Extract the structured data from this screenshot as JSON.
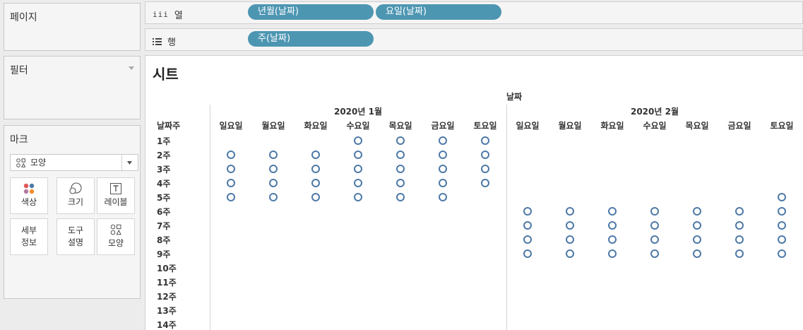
{
  "pages_card": {
    "title": "페이지"
  },
  "filters_card": {
    "title": "필터"
  },
  "marks_card": {
    "title": "마크",
    "mark_type": "모양",
    "buttons": [
      {
        "label": "색상",
        "icon": "color-dots-icon"
      },
      {
        "label": "크기",
        "icon": "size-icon"
      },
      {
        "label": "레이블",
        "icon": "label-text-icon"
      },
      {
        "label_line1": "세부",
        "label_line2": "정보",
        "icon": "none"
      },
      {
        "label_line1": "도구",
        "label_line2": "설명",
        "icon": "none"
      },
      {
        "label": "모양",
        "icon": "shape-icon"
      }
    ]
  },
  "columns_shelf": {
    "label": "열",
    "icon": "iii",
    "pills": [
      "년월(날짜)",
      "요일(날짜)"
    ]
  },
  "rows_shelf": {
    "label": "행",
    "pills": [
      "주(날짜)"
    ]
  },
  "sheet": {
    "title": "시트",
    "top_header": "날짜",
    "row_header": "날짜주",
    "months": [
      "2020년 1월",
      "2020년 2월"
    ],
    "weekdays": [
      "일요일",
      "월요일",
      "화요일",
      "수요일",
      "목요일",
      "금요일",
      "토요일"
    ],
    "weeks": [
      "1주",
      "2주",
      "3주",
      "4주",
      "5주",
      "6주",
      "7주",
      "8주",
      "9주",
      "10주",
      "11주",
      "12주",
      "13주",
      "14주"
    ]
  },
  "marks": {
    "color": "#4e79a7",
    "2020년 1월": {
      "1주": [
        3,
        4,
        5,
        6
      ],
      "2주": [
        0,
        1,
        2,
        3,
        4,
        5,
        6
      ],
      "3주": [
        0,
        1,
        2,
        3,
        4,
        5,
        6
      ],
      "4주": [
        0,
        1,
        2,
        3,
        4,
        5,
        6
      ],
      "5주": [
        0,
        1,
        2,
        3,
        4,
        5
      ]
    },
    "2020년 2월": {
      "5주": [
        6
      ],
      "6주": [
        0,
        1,
        2,
        3,
        4,
        5,
        6
      ],
      "7주": [
        0,
        1,
        2,
        3,
        4,
        5,
        6
      ],
      "8주": [
        0,
        1,
        2,
        3,
        4,
        5,
        6
      ],
      "9주": [
        0,
        1,
        2,
        3,
        4,
        5,
        6
      ]
    }
  }
}
